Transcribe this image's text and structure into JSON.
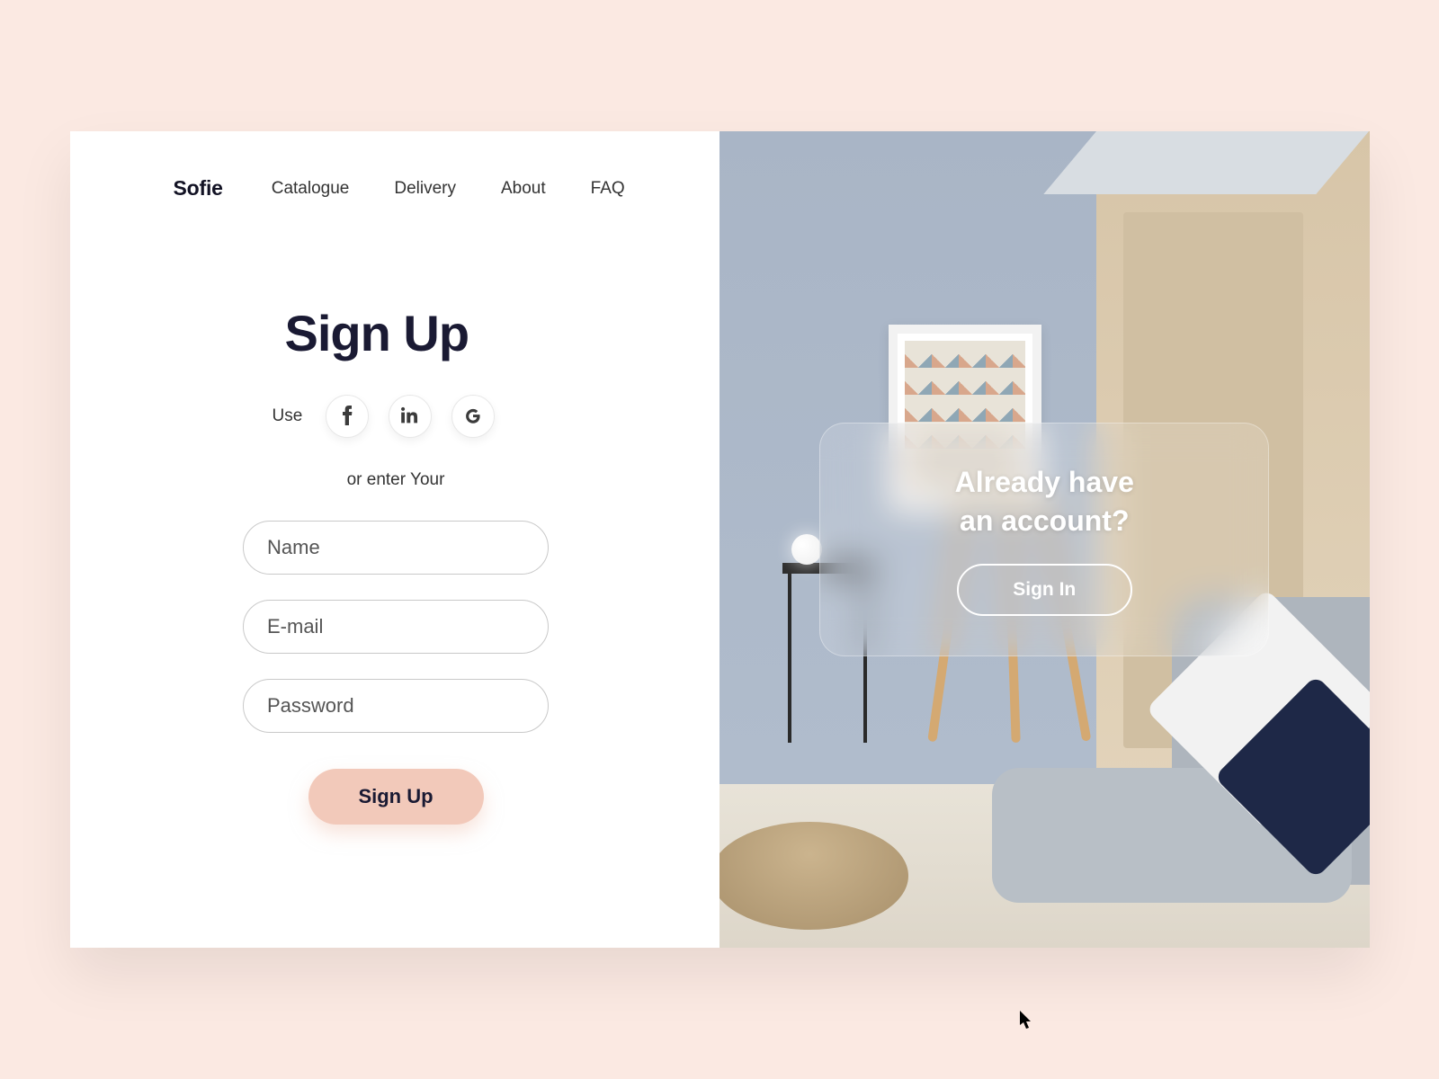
{
  "brand": "Sofie",
  "nav": {
    "items": [
      "Catalogue",
      "Delivery",
      "About",
      "FAQ"
    ]
  },
  "signup": {
    "title": "Sign Up",
    "use_label": "Use",
    "or_text": "or enter Your",
    "fields": {
      "name_placeholder": "Name",
      "email_placeholder": "E-mail",
      "password_placeholder": "Password"
    },
    "submit_label": "Sign Up"
  },
  "signin_overlay": {
    "title_line1": "Already have",
    "title_line2": "an account?",
    "button_label": "Sign In"
  },
  "colors": {
    "accent": "#f2c9ba",
    "background": "#fbe9e2",
    "text_dark": "#1a1a33"
  }
}
